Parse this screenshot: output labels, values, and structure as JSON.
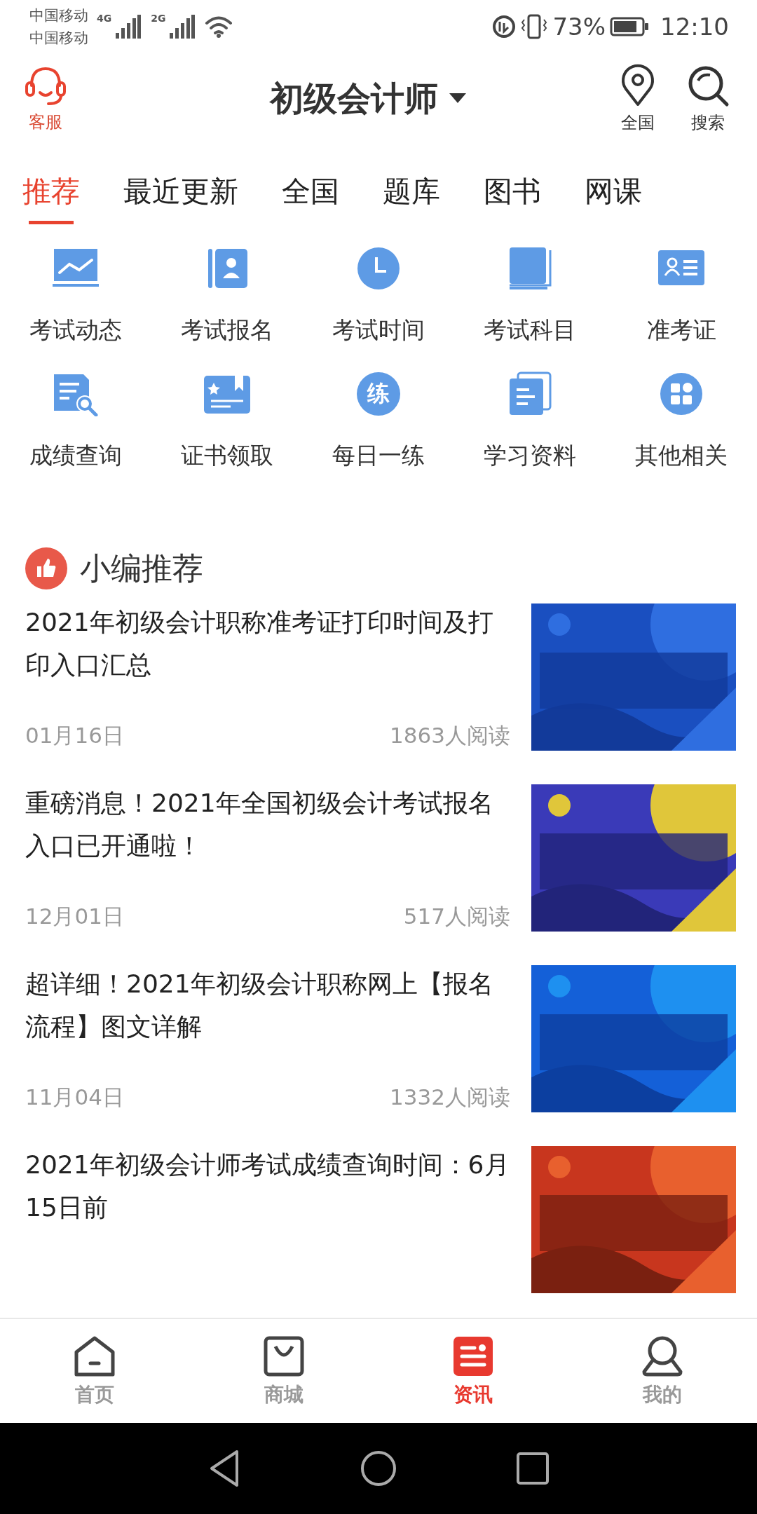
{
  "status_bar": {
    "carriers": [
      "中国移动",
      "中国移动"
    ],
    "net1": "4G",
    "net2": "2G",
    "battery": "73%",
    "time": "12:10"
  },
  "header": {
    "service": "客服",
    "title": "初级会计师",
    "region": "全国",
    "search": "搜索"
  },
  "tabs": [
    {
      "label": "推荐",
      "selected": true
    },
    {
      "label": "最近更新",
      "selected": false
    },
    {
      "label": "全国",
      "selected": false
    },
    {
      "label": "题库",
      "selected": false
    },
    {
      "label": "图书",
      "selected": false
    },
    {
      "label": "网课",
      "selected": false
    }
  ],
  "shortcuts": [
    {
      "kind": "chart",
      "label": "考试动态"
    },
    {
      "kind": "contact",
      "label": "考试报名"
    },
    {
      "kind": "clock",
      "label": "考试时间"
    },
    {
      "kind": "book",
      "label": "考试科目"
    },
    {
      "kind": "card",
      "label": "准考证"
    },
    {
      "kind": "search",
      "label": "成绩查询"
    },
    {
      "kind": "certificate",
      "label": "证书领取"
    },
    {
      "kind": "glyph",
      "glyph": "练",
      "label": "每日一练"
    },
    {
      "kind": "docs",
      "label": "学习资料"
    },
    {
      "kind": "apps",
      "label": "其他相关"
    }
  ],
  "section": {
    "title": "小编推荐"
  },
  "articles": [
    {
      "title": "2021年初级会计职称准考证打印时间及打印入口汇总",
      "date": "01月16日",
      "reads": "1863人阅读"
    },
    {
      "title": "重磅消息！2021年全国初级会计考试报名入口已开通啦！",
      "date": "12月01日",
      "reads": "517人阅读"
    },
    {
      "title": "超详细！2021年初级会计职称网上【报名流程】图文详解",
      "date": "11月04日",
      "reads": "1332人阅读"
    },
    {
      "title": "2021年初级会计师考试成绩查询时间：6月15日前"
    }
  ],
  "bottom_nav": [
    {
      "kind": "home",
      "label": "首页",
      "selected": false
    },
    {
      "kind": "shop",
      "label": "商城",
      "selected": false
    },
    {
      "kind": "news",
      "label": "资讯",
      "selected": true
    },
    {
      "kind": "user",
      "label": "我的",
      "selected": false
    }
  ]
}
